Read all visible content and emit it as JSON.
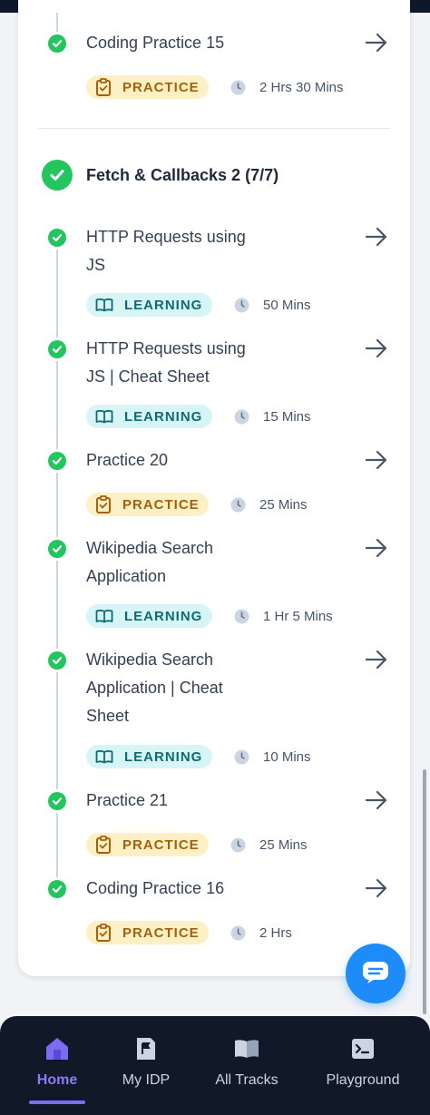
{
  "colors": {
    "success_green": "#22c55e",
    "practice_bg": "#fdf0c4",
    "practice_text": "#a65f0b",
    "learning_bg": "#d7f4f6",
    "learning_text": "#0f6b73",
    "fab_blue": "#1d8cf8",
    "nav_bg": "#111827",
    "nav_active": "#8b7cf6"
  },
  "previous_item": {
    "title": "Coding Practice 15",
    "type": "PRACTICE",
    "duration": "2 Hrs 30 Mins"
  },
  "section": {
    "title": "Fetch & Callbacks 2 (7/7)",
    "items": [
      {
        "title": "HTTP Requests using JS",
        "type": "LEARNING",
        "duration": "50 Mins"
      },
      {
        "title": "HTTP Requests using JS | Cheat Sheet",
        "type": "LEARNING",
        "duration": "15 Mins"
      },
      {
        "title": "Practice 20",
        "type": "PRACTICE",
        "duration": "25 Mins"
      },
      {
        "title": "Wikipedia Search Application",
        "type": "LEARNING",
        "duration": "1 Hr 5 Mins"
      },
      {
        "title": "Wikipedia Search Application | Cheat Sheet",
        "type": "LEARNING",
        "duration": "10 Mins"
      },
      {
        "title": "Practice 21",
        "type": "PRACTICE",
        "duration": "25 Mins"
      },
      {
        "title": "Coding Practice 16",
        "type": "PRACTICE",
        "duration": "2 Hrs"
      }
    ]
  },
  "icons": {
    "completed": "check-circle-icon",
    "arrow": "arrow-right-icon",
    "practice": "clipboard-check-icon",
    "learning": "book-open-icon",
    "duration": "clock-icon",
    "chat": "chat-bubble-icon"
  },
  "bottom_nav": [
    {
      "label": "Home",
      "icon": "home-icon",
      "active": true
    },
    {
      "label": "My IDP",
      "icon": "flag-document-icon",
      "active": false
    },
    {
      "label": "All Tracks",
      "icon": "book-icon",
      "active": false
    },
    {
      "label": "Playground",
      "icon": "terminal-icon",
      "active": false
    }
  ]
}
